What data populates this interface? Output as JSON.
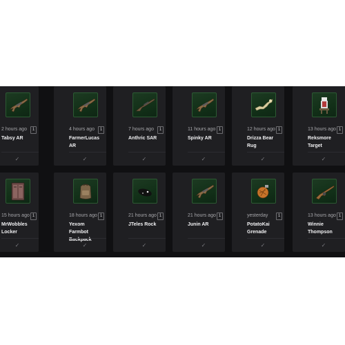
{
  "items": [
    {
      "time": "2 hours ago",
      "qty": "1",
      "name": "Tabsy AR",
      "icon": "assault-rifle-icon",
      "check": "✓"
    },
    {
      "time": "4 hours ago",
      "qty": "1",
      "name": "FarmerLucas AR",
      "icon": "assault-rifle-icon",
      "check": "✓"
    },
    {
      "time": "7 hours ago",
      "qty": "1",
      "name": "Anthric SAR",
      "icon": "semi-auto-rifle-icon",
      "check": "✓"
    },
    {
      "time": "11 hours ago",
      "qty": "1",
      "name": "Spinky AR",
      "icon": "assault-rifle-icon",
      "check": "✓"
    },
    {
      "time": "12 hours ago",
      "qty": "1",
      "name": "Drizza Bear Rug",
      "icon": "bear-rug-icon",
      "check": "✓"
    },
    {
      "time": "13 hours ago",
      "qty": "1",
      "name": "Reksmore Target",
      "icon": "target-icon",
      "check": "✓"
    },
    {
      "time": "15 hours ago",
      "qty": "1",
      "name": "MrWobbles Locker",
      "icon": "locker-icon",
      "check": "✓"
    },
    {
      "time": "18 hours ago",
      "qty": "1",
      "name": "Yexom Farmbot Backpack",
      "icon": "backpack-icon",
      "check": "✓"
    },
    {
      "time": "21 hours ago",
      "qty": "1",
      "name": "JTeles Rock",
      "icon": "rock-icon",
      "check": "✓"
    },
    {
      "time": "21 hours ago",
      "qty": "1",
      "name": "Junin AR",
      "icon": "assault-rifle-icon",
      "check": "✓"
    },
    {
      "time": "yesterday",
      "qty": "1",
      "name": "PotatoKai Grenade",
      "icon": "grenade-icon",
      "check": "✓"
    },
    {
      "time": "13 hours ago",
      "qty": "1",
      "name": "Winnie Thompson",
      "icon": "thompson-icon",
      "check": "✓"
    }
  ]
}
